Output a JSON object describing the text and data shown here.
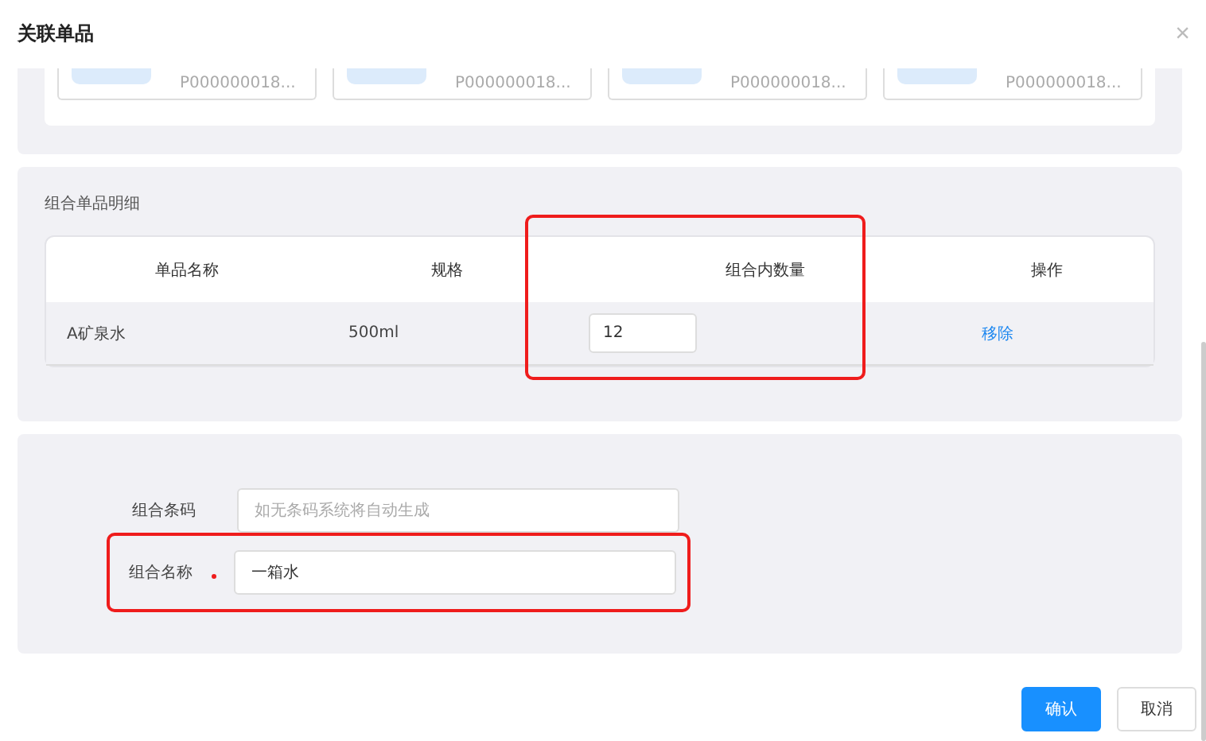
{
  "dialog": {
    "title": "关联单品",
    "close": "×"
  },
  "product_cards": [
    {
      "code": "P000000018..."
    },
    {
      "code": "P000000018..."
    },
    {
      "code": "P000000018..."
    },
    {
      "code": "P000000018..."
    }
  ],
  "detail": {
    "title": "组合单品明细",
    "columns": [
      "单品名称",
      "规格",
      "组合内数量",
      "操作"
    ],
    "rows": [
      {
        "name": "A矿泉水",
        "spec": "500ml",
        "quantity": "12",
        "action": "移除"
      }
    ]
  },
  "form": {
    "fields": [
      {
        "label": "组合条码",
        "required": false,
        "placeholder": "如无条码系统将自动生成",
        "highlighted": false
      },
      {
        "label": "组合名称",
        "required": true,
        "value": "一箱水",
        "highlighted": true
      }
    ]
  },
  "buttons": [
    {
      "label": "确认",
      "primary": true
    },
    {
      "label": "取消",
      "primary": false
    }
  ]
}
